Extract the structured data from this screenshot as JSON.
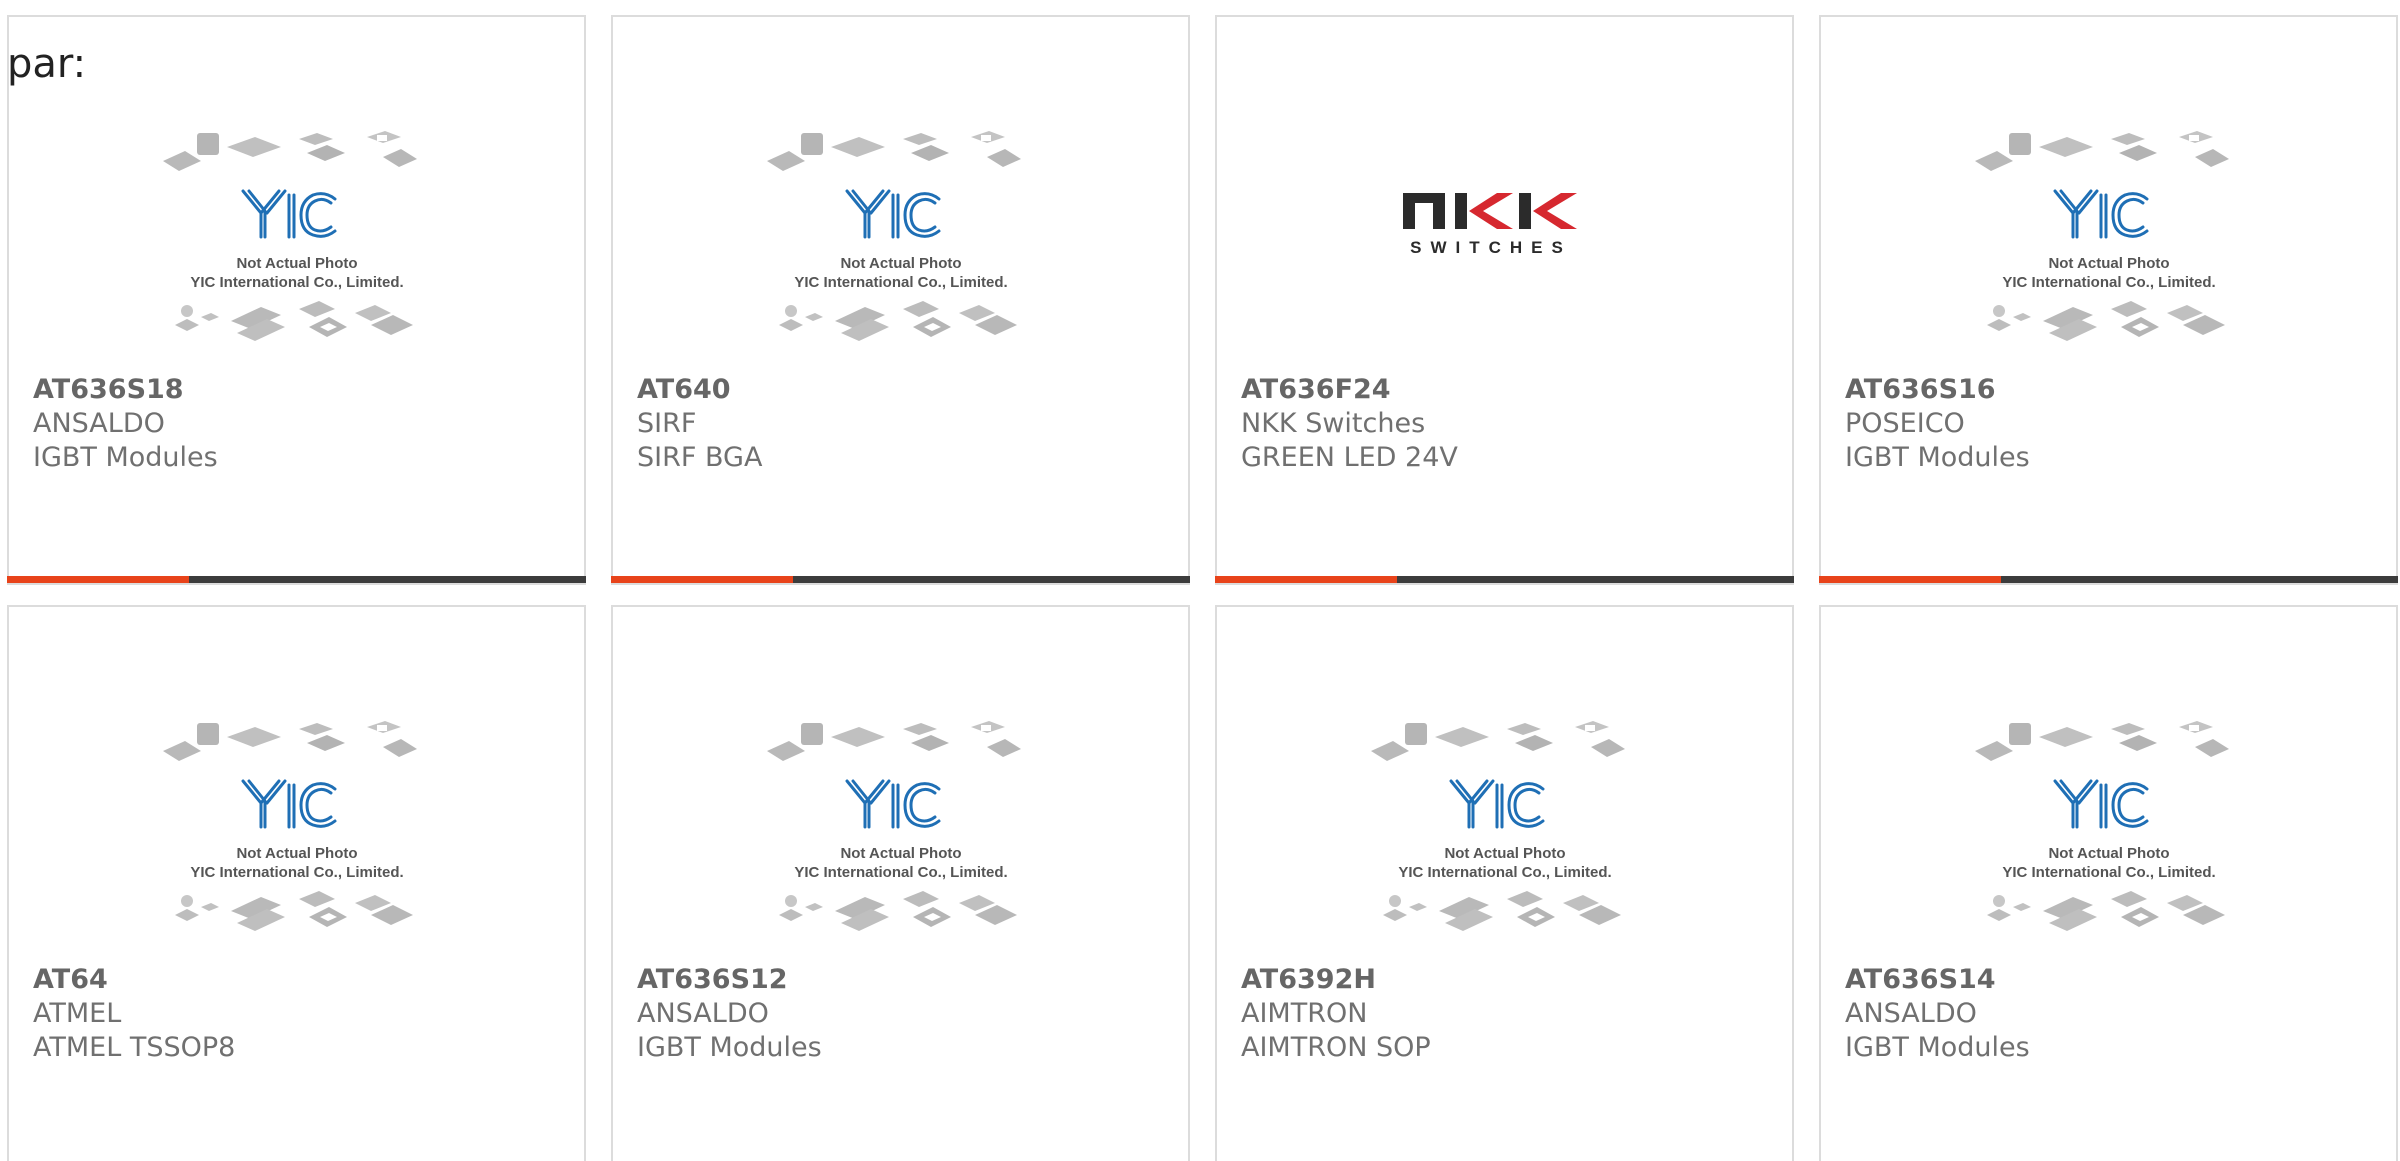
{
  "prefix_text": "par:",
  "placeholder": {
    "line1": "Not Actual Photo",
    "line2": "YIC International Co., Limited."
  },
  "nkk_logo": {
    "word": "NKK",
    "sub": "SWITCHES"
  },
  "colors": {
    "accent": "#e8431a",
    "bar_dark": "#3c3c3c",
    "yic_blue": "#1f6fb5",
    "nkk_red": "#d6282f",
    "nkk_dark": "#2b2b2b"
  },
  "products": [
    {
      "part": "AT636S18",
      "brand": "ANSALDO",
      "desc": "IGBT Modules",
      "image": "yic-placeholder"
    },
    {
      "part": "AT640",
      "brand": "SIRF",
      "desc": "SIRF BGA",
      "image": "yic-placeholder"
    },
    {
      "part": "AT636F24",
      "brand": "NKK Switches",
      "desc": "GREEN LED 24V",
      "image": "nkk-logo"
    },
    {
      "part": "AT636S16",
      "brand": "POSEICO",
      "desc": "IGBT Modules",
      "image": "yic-placeholder"
    },
    {
      "part": "AT64",
      "brand": "ATMEL",
      "desc": "ATMEL TSSOP8",
      "image": "yic-placeholder"
    },
    {
      "part": "AT636S12",
      "brand": "ANSALDO",
      "desc": "IGBT Modules",
      "image": "yic-placeholder"
    },
    {
      "part": "AT6392H",
      "brand": "AIMTRON",
      "desc": "AIMTRON SOP",
      "image": "yic-placeholder"
    },
    {
      "part": "AT636S14",
      "brand": "ANSALDO",
      "desc": "IGBT Modules",
      "image": "yic-placeholder"
    }
  ]
}
